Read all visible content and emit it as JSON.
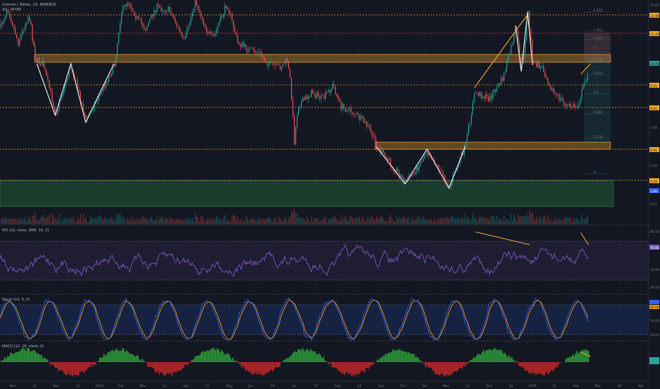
{
  "colors": {
    "background": "#131722",
    "grid": "#1e222d",
    "candle_up": "#26a69a",
    "candle_down": "#ef5350",
    "support_zone": "#f0a030",
    "demand_zone": "#2e9e4a",
    "pattern_line": "#e8e8e8",
    "trend_line": "#f5a623",
    "rsi_line": "#7e57c2",
    "stoch_k": "#2962ff",
    "stoch_d": "#ff9800",
    "macd_up": "#26a69a",
    "macd_down": "#ef5350",
    "fib_red": "#e0464e",
    "dotted_orange": "#f5a623"
  },
  "header": {
    "symbol_line": "Cosmos / Tether, 1D, BINANCE",
    "vol_line": "Vol · ATOM"
  },
  "panes": {
    "rsi_title": "RSI (14, close, SMA, 14, 2)",
    "stoch_title": "Stoch (14, 3, 3)",
    "macd_title": "MACD (12, 26, close, 9)"
  },
  "price_axis": {
    "labels": [
      "15.07",
      "12.96",
      "11.45",
      "10.05",
      "9.21",
      "8.60",
      "7.84",
      "6.95",
      "5.65",
      "4.38",
      "3.80",
      "3.15"
    ]
  },
  "rsi_axis": {
    "labels": [
      "80.00",
      "70.00",
      "50.00",
      "30.00"
    ]
  },
  "stoch_axis": {
    "labels": [
      "80.00",
      "50.00",
      "20.00"
    ]
  },
  "time_axis": {
    "labels": [
      "Nov",
      "15",
      "Dec",
      "13",
      "2023",
      "Feb",
      "Mar",
      "13",
      "Apr",
      "17",
      "May",
      "Jun",
      "19",
      "Jul",
      "17",
      "Aug",
      "14",
      "Sep",
      "Oct",
      "16",
      "Nov",
      "13",
      "Dec",
      "18",
      "2024",
      "15",
      "Feb",
      "Mar",
      "18",
      "Apr"
    ]
  },
  "chart_data": [
    {
      "type": "candlestick",
      "title": "Cosmos / Tether, 1D, BINANCE",
      "annotations": {
        "horizontal_levels_dotted": [
          15.07,
          12.96,
          10.05,
          9.21,
          7.84,
          5.65,
          4.38
        ],
        "resistance_zone": [
          11.45,
          12.1
        ],
        "support_zone": [
          7.84,
          8.2
        ],
        "demand_zone": [
          4.38,
          5.2
        ],
        "patterns": [
          "double bottom (W) near 10.05",
          "triple bottom (W) near 4.38",
          "rising wedge top near 15.07"
        ],
        "fib_levels_right": [
          "1.618",
          "1.414",
          "1.272",
          "1",
          "0.786",
          "0.618",
          "0.5",
          "0.382",
          "0.236",
          "0"
        ]
      }
    },
    {
      "type": "line",
      "title": "RSI (14, close, SMA, 14, 2)",
      "ylim": [
        20,
        85
      ],
      "bands": [
        30,
        70
      ]
    },
    {
      "type": "line",
      "title": "Stoch (14, 3, 3)",
      "ylim": [
        0,
        100
      ],
      "bands": [
        20,
        80
      ]
    },
    {
      "type": "bar",
      "title": "MACD (12, 26, close, 9)"
    }
  ]
}
